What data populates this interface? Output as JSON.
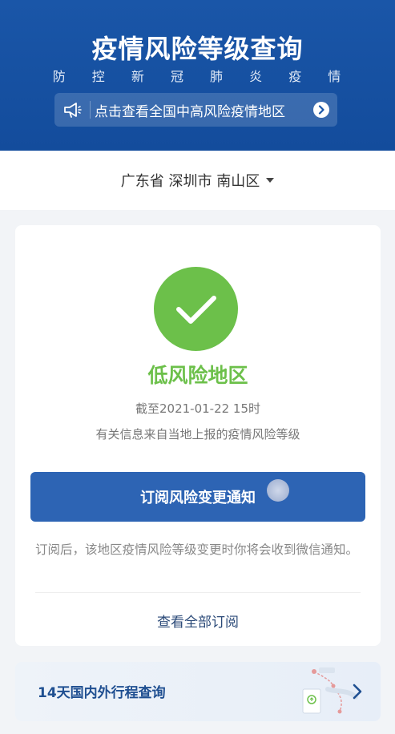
{
  "header": {
    "title": "疫情风险等级查询",
    "subtitle": "防 控 新 冠 肺 炎 疫 情",
    "notice_text": "点击查看全国中高风险疫情地区",
    "colors": {
      "background": "#1a56a8"
    }
  },
  "location": {
    "text": "广东省 深圳市 南山区"
  },
  "status": {
    "level": "低风险地区",
    "level_color": "#6cc04a",
    "as_of": "截至2021-01-22 15时",
    "source": "有关信息来自当地上报的疫情风险等级"
  },
  "subscribe": {
    "button_label": "订阅风险变更通知",
    "note": "订阅后，该地区疫情风险等级变更时你将会收到微信通知。",
    "view_all": "查看全部订阅"
  },
  "trip": {
    "label": "14天国内外行程查询"
  },
  "icons": [
    "megaphone-icon",
    "chevron-right-icon",
    "caret-down-icon",
    "check-icon",
    "map-route-icon"
  ]
}
